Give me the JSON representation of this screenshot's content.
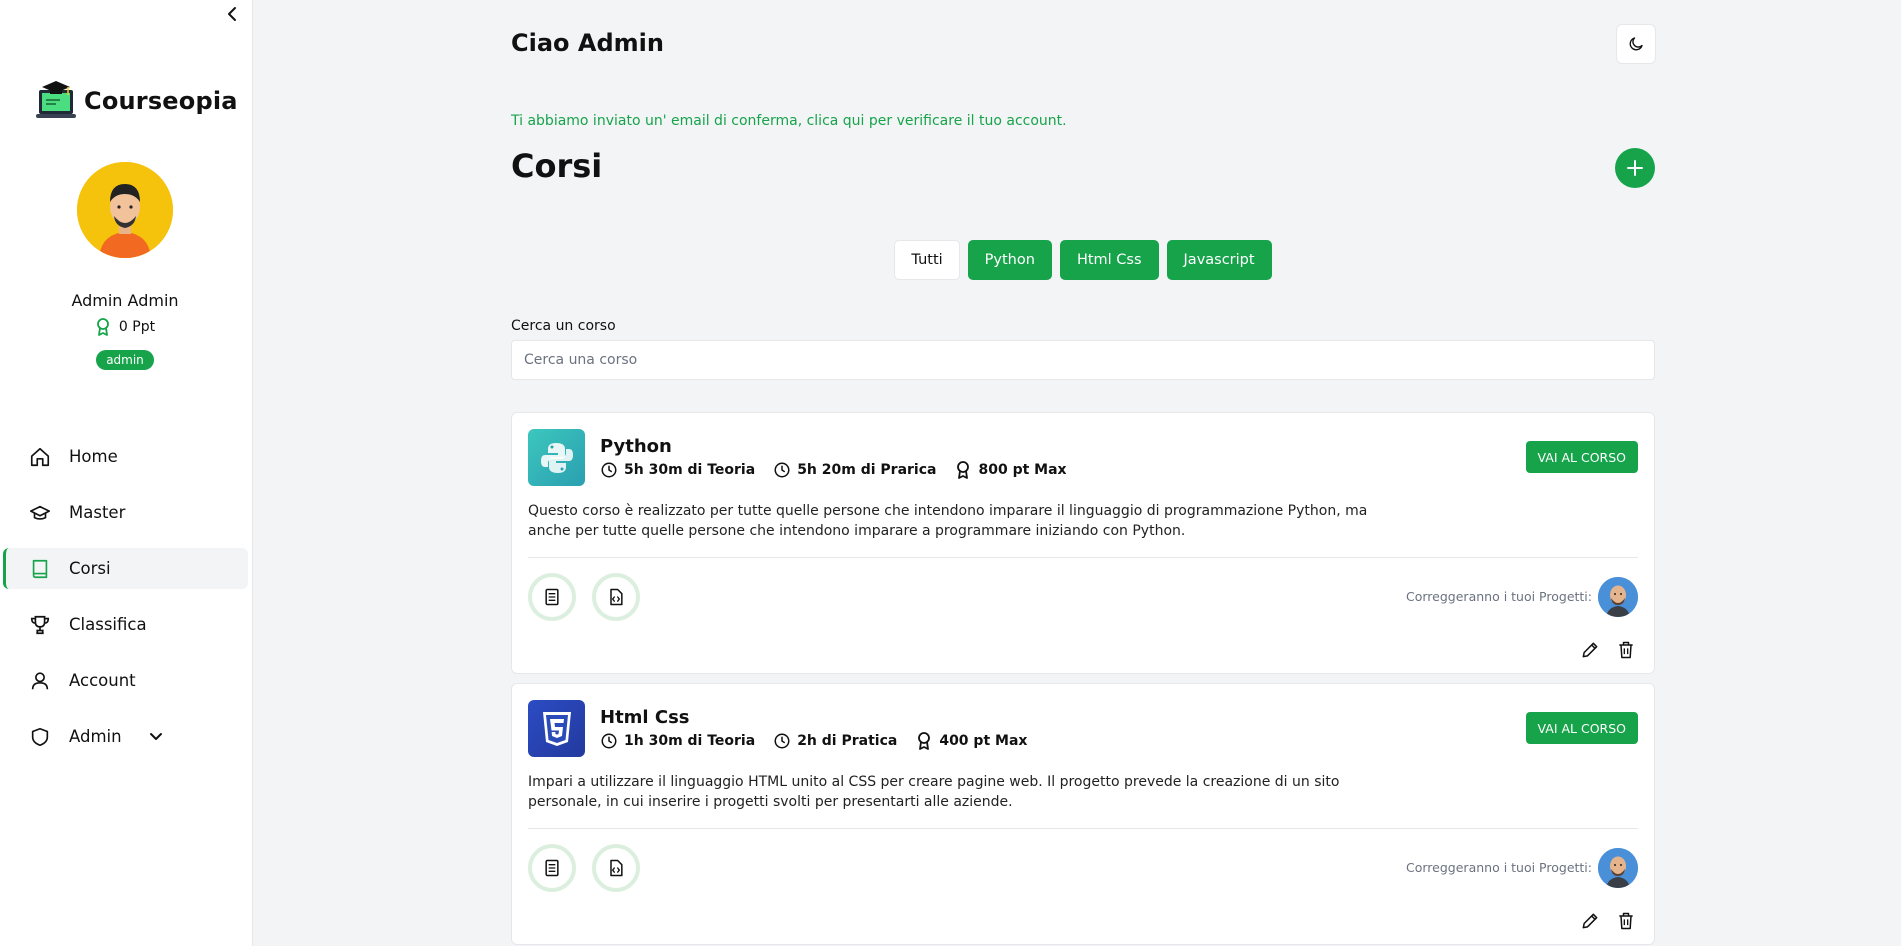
{
  "brand": {
    "name": "Courseopia"
  },
  "user": {
    "name": "Admin Admin",
    "points": "0 Ppt",
    "role": "admin"
  },
  "nav": {
    "items": [
      {
        "label": "Home",
        "icon": "home-icon"
      },
      {
        "label": "Master",
        "icon": "graduation-cap-icon"
      },
      {
        "label": "Corsi",
        "icon": "book-icon",
        "active": true
      },
      {
        "label": "Classifica",
        "icon": "trophy-icon"
      },
      {
        "label": "Account",
        "icon": "user-icon"
      },
      {
        "label": "Admin",
        "icon": "shield-icon",
        "expandable": true
      }
    ]
  },
  "header": {
    "greeting": "Ciao Admin"
  },
  "notice": {
    "text": "Ti abbiamo inviato un' email di conferma, clica qui per verificare il tuo account."
  },
  "page": {
    "title": "Corsi"
  },
  "filters": [
    "Tutti",
    "Python",
    "Html Css",
    "Javascript"
  ],
  "search": {
    "label": "Cerca un corso",
    "placeholder": "Cerca una corso"
  },
  "courses": [
    {
      "title": "Python",
      "theory": "5h 30m di Teoria",
      "practice": "5h 20m di Prarica",
      "points": "800 pt Max",
      "cta": "VAI AL CORSO",
      "description": "Questo corso è realizzato per tutte quelle persone che intendono imparare il linguaggio di programmazione Python, ma anche per tutte quelle persone che intendono imparare a programmare iniziando con Python.",
      "reviewers_label": "Correggeranno i tuoi Progetti:",
      "logo_color": "#2fb8b0"
    },
    {
      "title": "Html Css",
      "theory": "1h 30m di Teoria",
      "practice": "2h di Pratica",
      "points": "400 pt Max",
      "cta": "VAI AL CORSO",
      "description": "Impari a utilizzare il linguaggio HTML unito al CSS per creare pagine web. Il progetto prevede la creazione di un sito personale, in cui inserire i progetti svolti per presentarti alle aziende.",
      "reviewers_label": "Correggeranno i tuoi Progetti:",
      "logo_color": "#2a4bb8"
    }
  ],
  "colors": {
    "accent": "#16a34a",
    "background": "#f3f4f6"
  }
}
